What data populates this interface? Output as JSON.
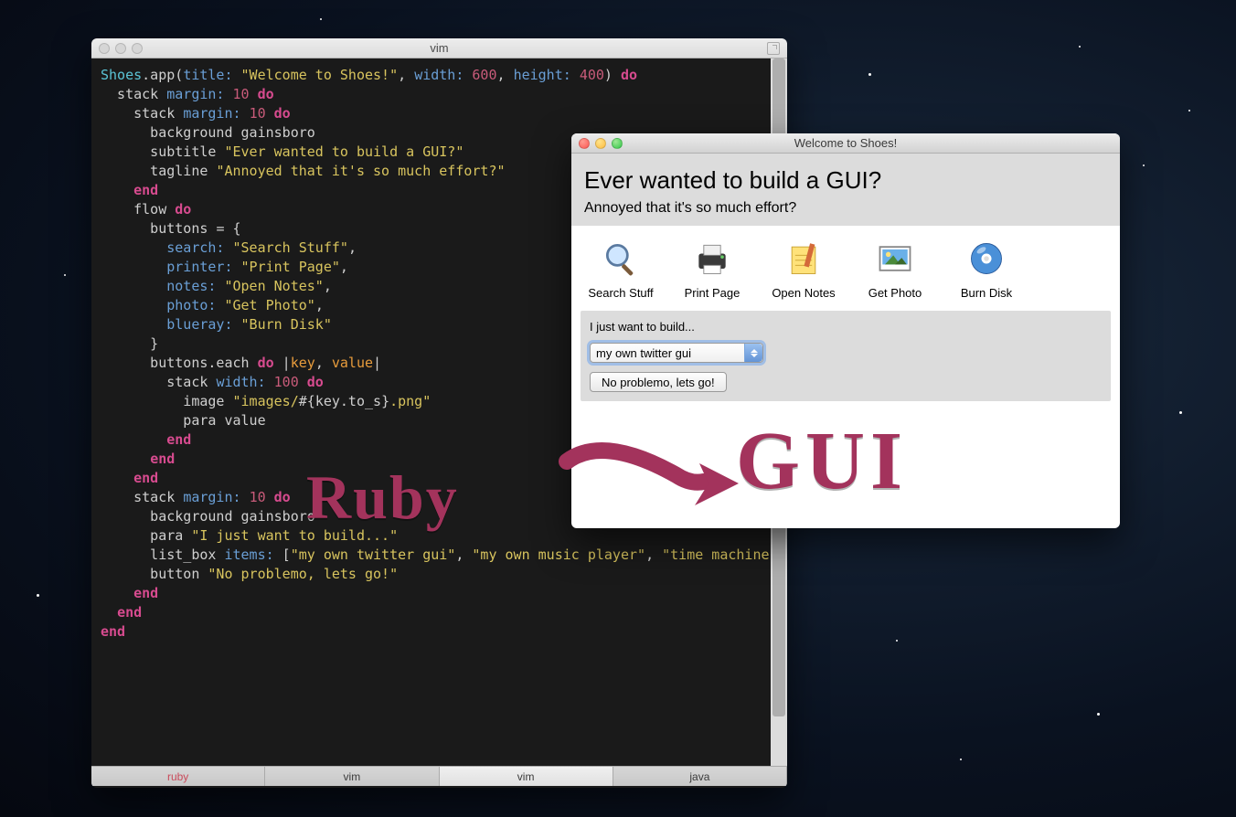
{
  "vim": {
    "title": "vim",
    "tabs": [
      "ruby",
      "vim",
      "vim",
      "java"
    ],
    "code": [
      {
        "seg": [
          {
            "c": "kw-cyan",
            "t": "Shoes"
          },
          {
            "c": "kw-grey",
            "t": ".app("
          },
          {
            "c": "kw-blue",
            "t": "title:"
          },
          {
            "c": "kw-grey",
            "t": " "
          },
          {
            "c": "kw-yellow",
            "t": "\"Welcome to Shoes!\""
          },
          {
            "c": "kw-grey",
            "t": ", "
          },
          {
            "c": "kw-blue",
            "t": "width:"
          },
          {
            "c": "kw-grey",
            "t": " "
          },
          {
            "c": "kw-num",
            "t": "600"
          },
          {
            "c": "kw-grey",
            "t": ", "
          },
          {
            "c": "kw-blue",
            "t": "height:"
          },
          {
            "c": "kw-grey",
            "t": " "
          },
          {
            "c": "kw-num",
            "t": "400"
          },
          {
            "c": "kw-grey",
            "t": ") "
          },
          {
            "c": "kw-pink",
            "t": "do"
          }
        ]
      },
      {
        "seg": [
          {
            "c": "kw-grey",
            "t": "  stack "
          },
          {
            "c": "kw-blue",
            "t": "margin:"
          },
          {
            "c": "kw-grey",
            "t": " "
          },
          {
            "c": "kw-num",
            "t": "10"
          },
          {
            "c": "kw-grey",
            "t": " "
          },
          {
            "c": "kw-pink",
            "t": "do"
          }
        ]
      },
      {
        "seg": [
          {
            "c": "kw-grey",
            "t": ""
          }
        ]
      },
      {
        "seg": [
          {
            "c": "kw-grey",
            "t": "    stack "
          },
          {
            "c": "kw-blue",
            "t": "margin:"
          },
          {
            "c": "kw-grey",
            "t": " "
          },
          {
            "c": "kw-num",
            "t": "10"
          },
          {
            "c": "kw-grey",
            "t": " "
          },
          {
            "c": "kw-pink",
            "t": "do"
          }
        ]
      },
      {
        "seg": [
          {
            "c": "kw-grey",
            "t": "      background gainsboro"
          }
        ]
      },
      {
        "seg": [
          {
            "c": "kw-grey",
            "t": "      subtitle "
          },
          {
            "c": "kw-yellow",
            "t": "\"Ever wanted to build a GUI?\""
          }
        ]
      },
      {
        "seg": [
          {
            "c": "kw-grey",
            "t": "      tagline "
          },
          {
            "c": "kw-yellow",
            "t": "\"Annoyed that it's so much effort?\""
          }
        ]
      },
      {
        "seg": [
          {
            "c": "kw-grey",
            "t": "    "
          },
          {
            "c": "kw-pink",
            "t": "end"
          }
        ]
      },
      {
        "seg": [
          {
            "c": "kw-grey",
            "t": ""
          }
        ]
      },
      {
        "seg": [
          {
            "c": "kw-grey",
            "t": "    flow "
          },
          {
            "c": "kw-pink",
            "t": "do"
          }
        ]
      },
      {
        "seg": [
          {
            "c": "kw-grey",
            "t": "      buttons "
          },
          {
            "c": "kw-grey",
            "t": "= {"
          }
        ]
      },
      {
        "seg": [
          {
            "c": "kw-grey",
            "t": "        "
          },
          {
            "c": "kw-blue",
            "t": "search:"
          },
          {
            "c": "kw-grey",
            "t": " "
          },
          {
            "c": "kw-yellow",
            "t": "\"Search Stuff\""
          },
          {
            "c": "kw-grey",
            "t": ","
          }
        ]
      },
      {
        "seg": [
          {
            "c": "kw-grey",
            "t": "        "
          },
          {
            "c": "kw-blue",
            "t": "printer:"
          },
          {
            "c": "kw-grey",
            "t": " "
          },
          {
            "c": "kw-yellow",
            "t": "\"Print Page\""
          },
          {
            "c": "kw-grey",
            "t": ","
          }
        ]
      },
      {
        "seg": [
          {
            "c": "kw-grey",
            "t": "        "
          },
          {
            "c": "kw-blue",
            "t": "notes:"
          },
          {
            "c": "kw-grey",
            "t": " "
          },
          {
            "c": "kw-yellow",
            "t": "\"Open Notes\""
          },
          {
            "c": "kw-grey",
            "t": ","
          }
        ]
      },
      {
        "seg": [
          {
            "c": "kw-grey",
            "t": "        "
          },
          {
            "c": "kw-blue",
            "t": "photo:"
          },
          {
            "c": "kw-grey",
            "t": " "
          },
          {
            "c": "kw-yellow",
            "t": "\"Get Photo\""
          },
          {
            "c": "kw-grey",
            "t": ","
          }
        ]
      },
      {
        "seg": [
          {
            "c": "kw-grey",
            "t": "        "
          },
          {
            "c": "kw-blue",
            "t": "blueray:"
          },
          {
            "c": "kw-grey",
            "t": " "
          },
          {
            "c": "kw-yellow",
            "t": "\"Burn Disk\""
          }
        ]
      },
      {
        "seg": [
          {
            "c": "kw-grey",
            "t": "      }"
          }
        ]
      },
      {
        "seg": [
          {
            "c": "kw-grey",
            "t": ""
          }
        ]
      },
      {
        "seg": [
          {
            "c": "kw-grey",
            "t": "      buttons.each "
          },
          {
            "c": "kw-pink",
            "t": "do"
          },
          {
            "c": "kw-grey",
            "t": " |"
          },
          {
            "c": "kw-orange",
            "t": "key"
          },
          {
            "c": "kw-grey",
            "t": ", "
          },
          {
            "c": "kw-orange",
            "t": "value"
          },
          {
            "c": "kw-grey",
            "t": "|"
          }
        ]
      },
      {
        "seg": [
          {
            "c": "kw-grey",
            "t": "        stack "
          },
          {
            "c": "kw-blue",
            "t": "width:"
          },
          {
            "c": "kw-grey",
            "t": " "
          },
          {
            "c": "kw-num",
            "t": "100"
          },
          {
            "c": "kw-grey",
            "t": " "
          },
          {
            "c": "kw-pink",
            "t": "do"
          }
        ]
      },
      {
        "seg": [
          {
            "c": "kw-grey",
            "t": "          image "
          },
          {
            "c": "kw-yellow",
            "t": "\"images/"
          },
          {
            "c": "kw-grey",
            "t": "#{"
          },
          {
            "c": "kw-grey",
            "t": "key.to_s"
          },
          {
            "c": "kw-grey",
            "t": "}"
          },
          {
            "c": "kw-yellow",
            "t": ".png\""
          }
        ]
      },
      {
        "seg": [
          {
            "c": "kw-grey",
            "t": "          para value"
          }
        ]
      },
      {
        "seg": [
          {
            "c": "kw-grey",
            "t": "        "
          },
          {
            "c": "kw-pink",
            "t": "end"
          }
        ]
      },
      {
        "seg": [
          {
            "c": "kw-grey",
            "t": "      "
          },
          {
            "c": "kw-pink",
            "t": "end"
          }
        ]
      },
      {
        "seg": [
          {
            "c": "kw-grey",
            "t": "    "
          },
          {
            "c": "kw-pink",
            "t": "end"
          }
        ]
      },
      {
        "seg": [
          {
            "c": "kw-grey",
            "t": ""
          }
        ]
      },
      {
        "seg": [
          {
            "c": "kw-grey",
            "t": "    stack "
          },
          {
            "c": "kw-blue",
            "t": "margin:"
          },
          {
            "c": "kw-grey",
            "t": " "
          },
          {
            "c": "kw-num",
            "t": "10"
          },
          {
            "c": "kw-grey",
            "t": " "
          },
          {
            "c": "kw-pink",
            "t": "do"
          }
        ]
      },
      {
        "seg": [
          {
            "c": "kw-grey",
            "t": "      background gainsboro"
          }
        ]
      },
      {
        "seg": [
          {
            "c": "kw-grey",
            "t": "      para "
          },
          {
            "c": "kw-yellow",
            "t": "\"I just want to build...\""
          }
        ]
      },
      {
        "seg": [
          {
            "c": "kw-grey",
            "t": "      list_box "
          },
          {
            "c": "kw-blue",
            "t": "items:"
          },
          {
            "c": "kw-grey",
            "t": " ["
          },
          {
            "c": "kw-yellow",
            "t": "\"my own twitter gui\""
          },
          {
            "c": "kw-grey",
            "t": ", "
          },
          {
            "c": "kw-yellow",
            "t": "\"my own music player\""
          },
          {
            "c": "kw-grey",
            "t": ", "
          },
          {
            "c": "kw-yellow",
            "t": "\"time machine\""
          },
          {
            "c": "kw-grey",
            "t": "]"
          }
        ]
      },
      {
        "seg": [
          {
            "c": "kw-grey",
            "t": "      button "
          },
          {
            "c": "kw-yellow",
            "t": "\"No problemo, lets go!\""
          }
        ]
      },
      {
        "seg": [
          {
            "c": "kw-grey",
            "t": "    "
          },
          {
            "c": "kw-pink",
            "t": "end"
          }
        ]
      },
      {
        "seg": [
          {
            "c": "kw-grey",
            "t": "  "
          },
          {
            "c": "kw-pink",
            "t": "end"
          }
        ]
      },
      {
        "seg": [
          {
            "c": "kw-pink",
            "t": "end"
          }
        ]
      }
    ]
  },
  "shoes": {
    "title": "Welcome to Shoes!",
    "subtitle": "Ever wanted to build a GUI?",
    "tagline": "Annoyed that it's so much effort?",
    "tools": [
      {
        "label": "Search Stuff",
        "icon": "search-icon"
      },
      {
        "label": "Print Page",
        "icon": "printer-icon"
      },
      {
        "label": "Open Notes",
        "icon": "notes-icon"
      },
      {
        "label": "Get Photo",
        "icon": "photo-icon"
      },
      {
        "label": "Burn Disk",
        "icon": "disc-icon"
      }
    ],
    "para": "I just want to build...",
    "select_value": "my own twitter gui",
    "button": "No problemo, lets go!"
  },
  "annotations": {
    "ruby": "Ruby",
    "gui": "GUI"
  }
}
